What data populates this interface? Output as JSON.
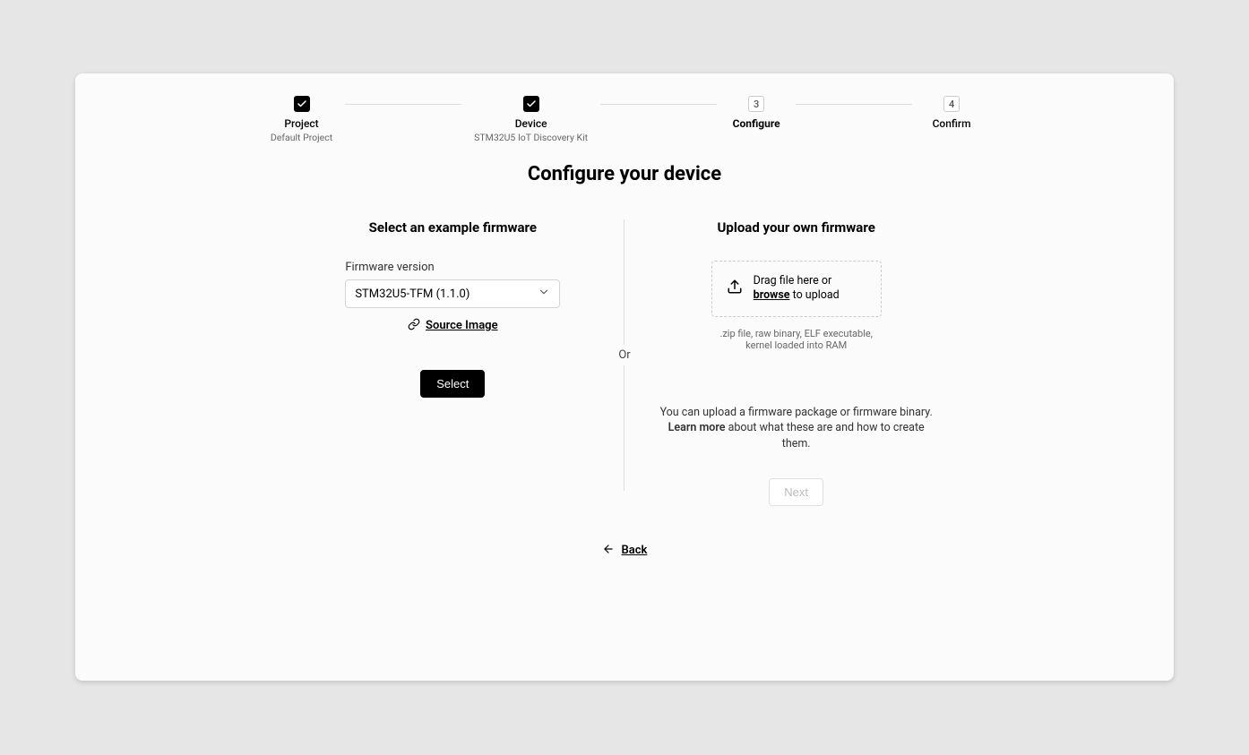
{
  "stepper": {
    "steps": [
      {
        "label": "Project",
        "sub": "Default Project",
        "state": "done"
      },
      {
        "label": "Device",
        "sub": "STM32U5 IoT Discovery Kit",
        "state": "done"
      },
      {
        "label": "Configure",
        "sub": "",
        "state": "active",
        "num": "3"
      },
      {
        "label": "Confirm",
        "sub": "",
        "state": "pending",
        "num": "4"
      }
    ]
  },
  "page_title": "Configure your device",
  "left": {
    "title": "Select an example firmware",
    "field_label": "Firmware version",
    "dropdown_value": "STM32U5-TFM (1.1.0)",
    "source_image": "Source Image",
    "select_btn": "Select"
  },
  "divider": {
    "or": "Or"
  },
  "right": {
    "title": "Upload your own firmware",
    "drop_prefix": "Drag file here or ",
    "drop_browse": "browse",
    "drop_suffix": " to upload",
    "file_hint": ".zip file, raw binary, ELF executable, kernel loaded into RAM",
    "desc_prefix": "You can upload a firmware package or firmware binary. ",
    "learn_more": "Learn more",
    "desc_suffix": " about what these are and how to create them.",
    "next_btn": "Next"
  },
  "back": "Back"
}
